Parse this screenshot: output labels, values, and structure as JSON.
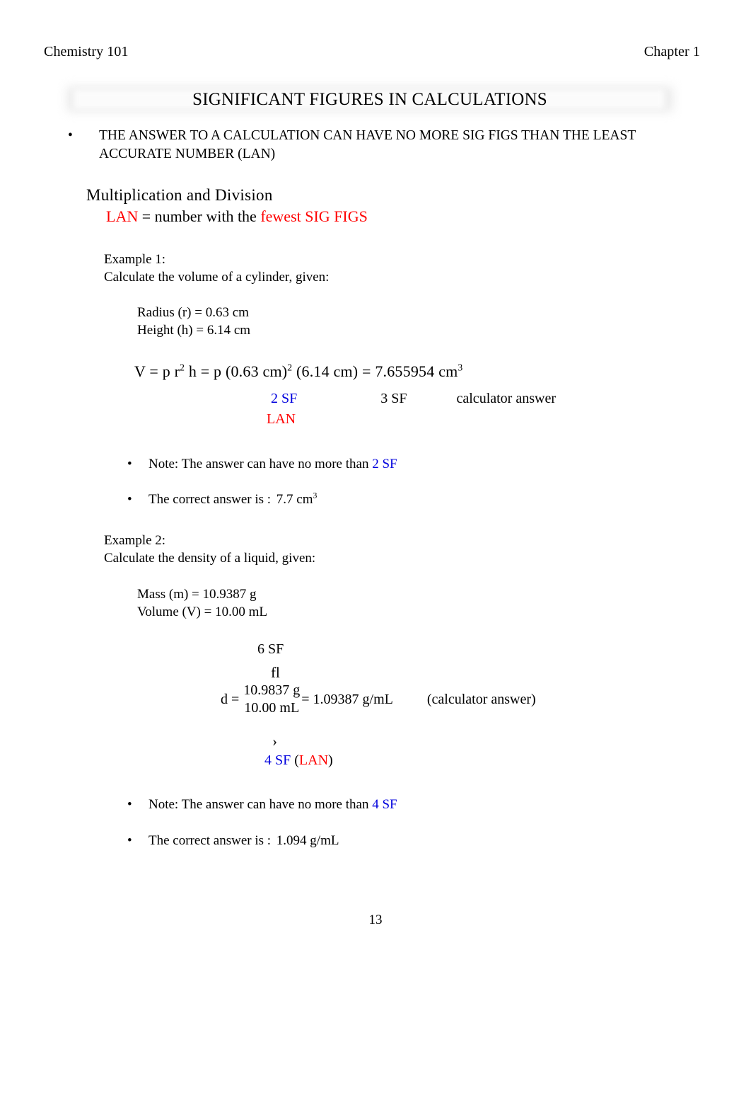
{
  "header": {
    "left": "Chemistry 101",
    "right": "Chapter 1"
  },
  "title": "SIGNIFICANT FIGURES IN CALCULATIONS",
  "top_bullet": {
    "marker": "•",
    "text": "THE ANSWER TO A CALCULATION CAN HAVE NO MORE SIG FIGS THAN THE LEAST ACCURATE NUMBER (LAN)"
  },
  "section": {
    "heading": "Multiplication  and  Division",
    "rule_lan": "LAN",
    "rule_mid": " = number with the ",
    "rule_end": "fewest SIG FIGS"
  },
  "example1": {
    "label": "Example 1:",
    "prompt": "Calculate the volume of a cylinder, given:",
    "given": [
      "Radius (r) = 0.63 cm",
      "Height (h) = 6.14 cm"
    ],
    "equation": {
      "lhs": "V = p  r",
      "lhs_sup": "2",
      "mid": " h  =  p  (0.63 cm)",
      "mid_sup": "2",
      "mid2": "  (6.14 cm) = 7.655954 cm",
      "end_sup": "3"
    },
    "labels": {
      "sf_lan": "2 SF",
      "sf_other": "3 SF",
      "calc": "calculator answer",
      "lan": "LAN"
    },
    "note": {
      "marker": "•",
      "prefix": "Note: The answer can have no more than ",
      "sf": "2 SF"
    },
    "answer": {
      "marker": "•",
      "prefix": "The correct answer is : ",
      "value": "7.7 cm",
      "value_sup": "3"
    }
  },
  "example2": {
    "label": "Example 2:",
    "prompt": "Calculate the density of a liquid, given:",
    "given": [
      "Mass (m) = 10.9387 g",
      "Volume (V) = 10.00 mL"
    ],
    "equation": {
      "sf_top": "6 SF",
      "arrow_up": "fl",
      "lhs": "d = ",
      "numerator": "10.9837 g",
      "denominator": "10.00 mL",
      "rhs": "= 1.09387 g/mL",
      "calc": "(calculator answer)",
      "arrow_down": "›",
      "sf_bottom": "4 SF",
      "lan_open": " (",
      "lan": "LAN",
      "lan_close": ")"
    },
    "note": {
      "marker": "•",
      "prefix": "Note: The answer can have no more than ",
      "sf": "4 SF"
    },
    "answer": {
      "marker": "•",
      "prefix": "The correct answer is : ",
      "value": "1.094 g/mL"
    }
  },
  "page_number": "13",
  "colors": {
    "red": "#ff0000",
    "blue": "#0000dd",
    "highlight": "#ffe800",
    "text": "#000000"
  }
}
